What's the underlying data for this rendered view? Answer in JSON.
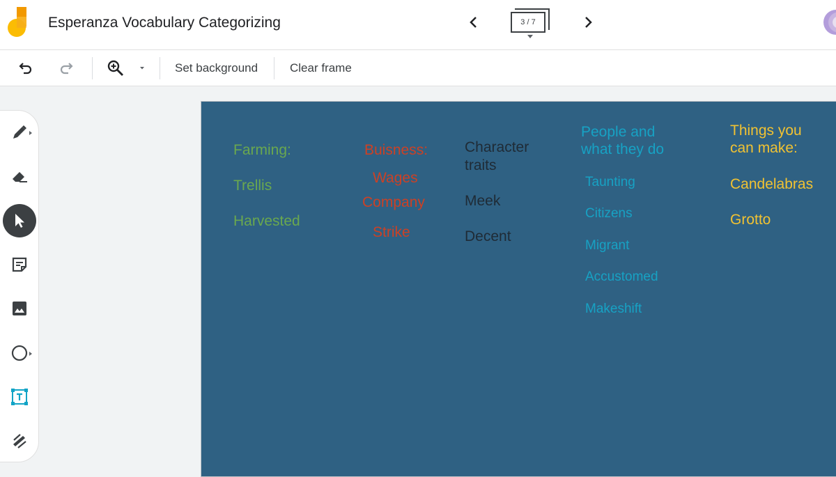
{
  "header": {
    "title": "Esperanza Vocabulary Categorizing",
    "frame_counter": "3 / 7",
    "colors": {
      "logo_orange": "#f29900",
      "logo_yellow": "#fbbc04"
    }
  },
  "toolbar": {
    "undo_icon": "undo-icon",
    "redo_icon": "redo-icon",
    "zoom_icon": "zoom-in-icon",
    "set_background": "Set background",
    "clear_frame": "Clear frame"
  },
  "tools": [
    "pen-icon",
    "eraser-icon",
    "select-arrow-icon",
    "sticky-note-icon",
    "image-icon",
    "circle-shape-icon",
    "text-box-icon",
    "laser-pointer-icon"
  ],
  "canvas": {
    "background": "#2f6183",
    "farming": {
      "heading": "Farming:",
      "items": [
        "Trellis",
        "Harvested"
      ]
    },
    "business": {
      "heading": "Buisness:",
      "items": [
        "Wages",
        "Company",
        "Strike"
      ]
    },
    "character": {
      "heading_line1": "Character",
      "heading_line2": "traits",
      "items": [
        "Meek",
        "Decent"
      ]
    },
    "people": {
      "heading_line1": "People and",
      "heading_line2": "what they do",
      "items": [
        "Taunting",
        "Citizens",
        "Migrant",
        "Accustomed",
        "Makeshift"
      ]
    },
    "things": {
      "heading_line1": "Things you",
      "heading_line2": "can make:",
      "items": [
        "Candelabras",
        "Grotto"
      ]
    }
  }
}
